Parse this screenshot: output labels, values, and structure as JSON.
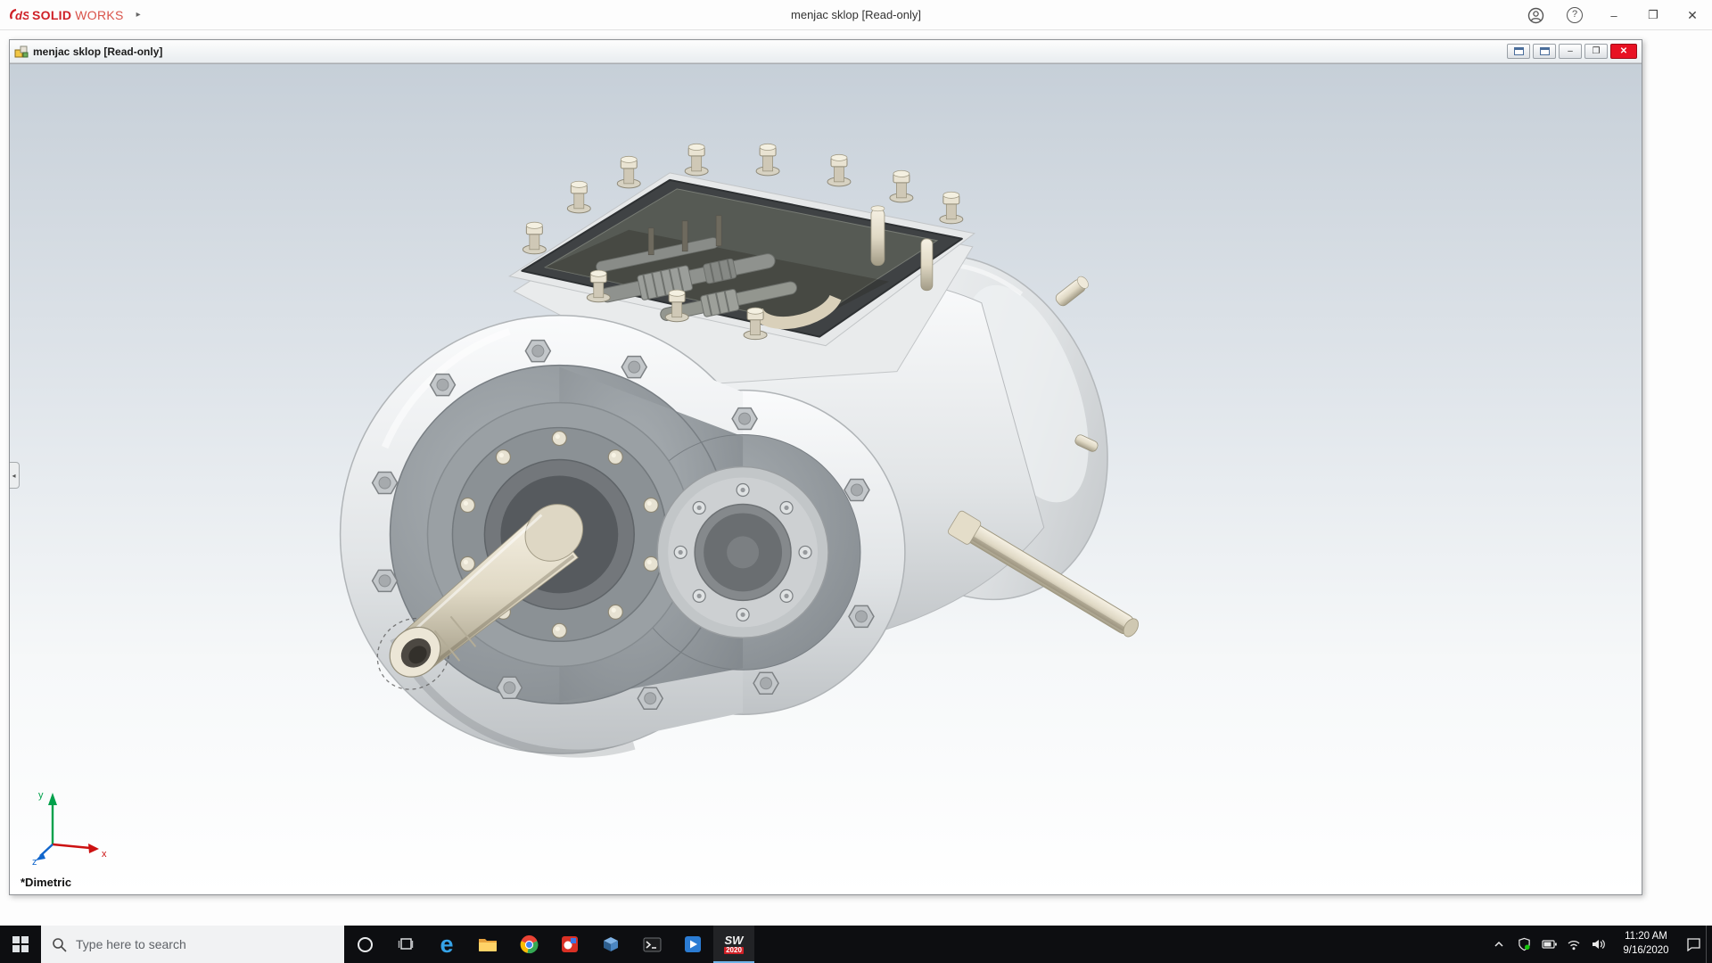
{
  "app": {
    "brand": {
      "mark": "dS",
      "solid": "SOLID",
      "works": "WORKS",
      "expand_arrow": "▸"
    },
    "title": "menjac sklop [Read-only]",
    "controls": {
      "help": "?",
      "minimize": "–",
      "restore": "❐",
      "close": "✕"
    }
  },
  "doc": {
    "title": "menjac sklop [Read-only]",
    "controls": {
      "minimize": "–",
      "restore": "❐",
      "close": "✕"
    },
    "view_label": "*Dimetric",
    "triad": {
      "x": "x",
      "y": "y",
      "z": "z"
    }
  },
  "taskbar": {
    "search_placeholder": "Type here to search",
    "apps": [
      {
        "name": "microsoft-edge",
        "glyph": "e"
      },
      {
        "name": "file-explorer"
      },
      {
        "name": "google-chrome"
      },
      {
        "name": "app-red"
      },
      {
        "name": "edrawings-cube"
      },
      {
        "name": "terminal"
      },
      {
        "name": "media-app"
      },
      {
        "name": "solidworks-2020",
        "label": "SW",
        "badge": "2020"
      }
    ],
    "clock": {
      "time": "11:20 AM",
      "date": "9/16/2020"
    }
  },
  "colors": {
    "solidworks_red": "#cf2027",
    "close_button_red": "#e81123",
    "taskbar_bg": "#0d0e11",
    "viewport_gradient_top": "#c6cfd8",
    "viewport_gradient_bottom": "#ffffff",
    "triad_x": "#cc1111",
    "triad_y": "#00a14b",
    "triad_z": "#1166cc"
  }
}
